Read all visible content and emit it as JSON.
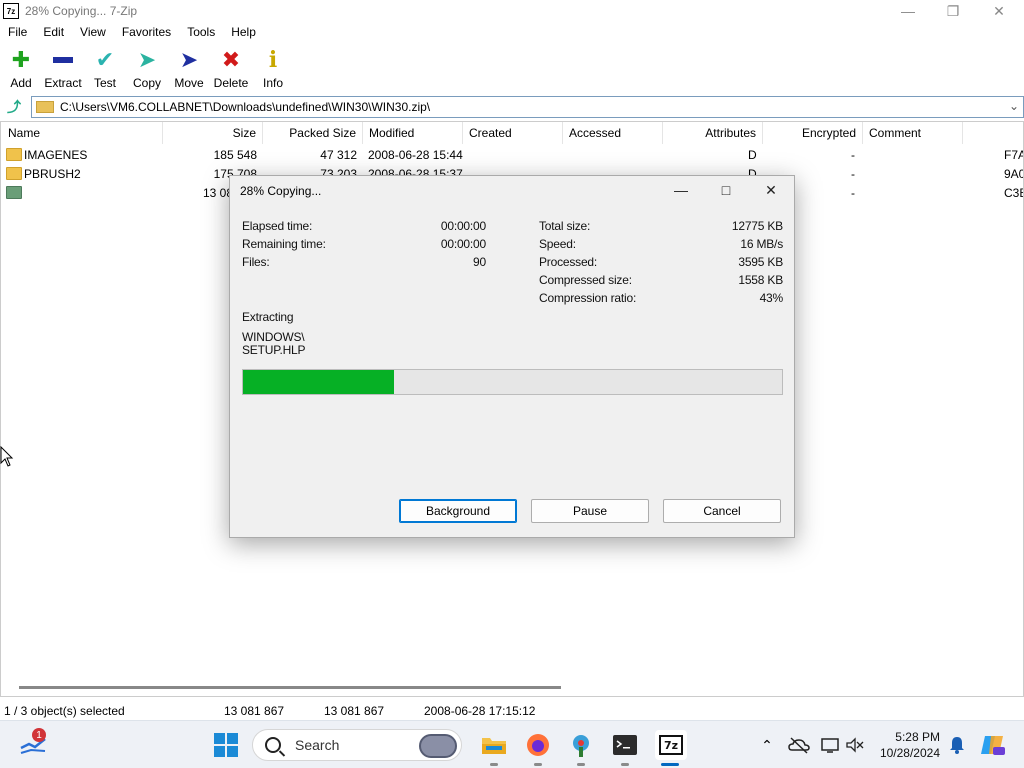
{
  "window": {
    "title": "28% Copying... 7-Zip",
    "app_icon": "7z"
  },
  "menu": [
    "File",
    "Edit",
    "View",
    "Favorites",
    "Tools",
    "Help"
  ],
  "toolbar": [
    {
      "label": "Add",
      "icon": "plus-icon",
      "color": "#1fa31f"
    },
    {
      "label": "Extract",
      "icon": "minus-icon",
      "color": "#1f2fa0"
    },
    {
      "label": "Test",
      "icon": "checkmark-icon",
      "color": "#2bb3b0"
    },
    {
      "label": "Copy",
      "icon": "arrow-right-icon",
      "color": "#2bb3a0"
    },
    {
      "label": "Move",
      "icon": "arrow-right-icon",
      "color": "#1f2fa0"
    },
    {
      "label": "Delete",
      "icon": "x-icon",
      "color": "#d11a1a"
    },
    {
      "label": "Info",
      "icon": "info-icon",
      "color": "#c8a800"
    }
  ],
  "address": "C:\\Users\\VM6.COLLABNET\\Downloads\\undefined\\WIN30\\WIN30.zip\\",
  "columns": [
    "Name",
    "Size",
    "Packed Size",
    "Modified",
    "Created",
    "Accessed",
    "Attributes",
    "Encrypted",
    "Comment"
  ],
  "rows": [
    {
      "name": "IMAGENES",
      "size": "185 548",
      "packed": "47 312",
      "modified": "2008-06-28 15:44",
      "attributes": "D",
      "encrypted": "-",
      "crc": "F7A"
    },
    {
      "name": "PBRUSH2",
      "size": "175 708",
      "packed": "73 203",
      "modified": "2008-06-28 15:37",
      "attributes": "D",
      "encrypted": "-",
      "crc": "9A0"
    },
    {
      "name": "",
      "size": "13 08",
      "packed": "",
      "modified": "",
      "attributes": "",
      "encrypted": "-",
      "crc": "C3E"
    }
  ],
  "status": {
    "selection": "1 / 3 object(s) selected",
    "size": "13 081 867",
    "packed": "13 081 867",
    "modified": "2008-06-28 17:15:12"
  },
  "dialog": {
    "title": "28% Copying...",
    "left": [
      {
        "label": "Elapsed time:",
        "value": "00:00:00"
      },
      {
        "label": "Remaining time:",
        "value": "00:00:00"
      },
      {
        "label": "Files:",
        "value": "90"
      }
    ],
    "right": [
      {
        "label": "Total size:",
        "value": "12775 KB"
      },
      {
        "label": "Speed:",
        "value": "16 MB/s"
      },
      {
        "label": "Processed:",
        "value": "3595 KB"
      },
      {
        "label": "Compressed size:",
        "value": "1558 KB"
      },
      {
        "label": "Compression ratio:",
        "value": "43%"
      }
    ],
    "operation": "Extracting",
    "path_line1": "WINDOWS\\",
    "path_line2": "SETUP.HLP",
    "progress_percent": 28,
    "progress_color": "#06b025",
    "buttons": {
      "background": "Background",
      "pause": "Pause",
      "cancel": "Cancel"
    }
  },
  "taskbar": {
    "search_placeholder": "Search",
    "time": "5:28 PM",
    "date": "10/28/2024",
    "notification_count": "1"
  }
}
